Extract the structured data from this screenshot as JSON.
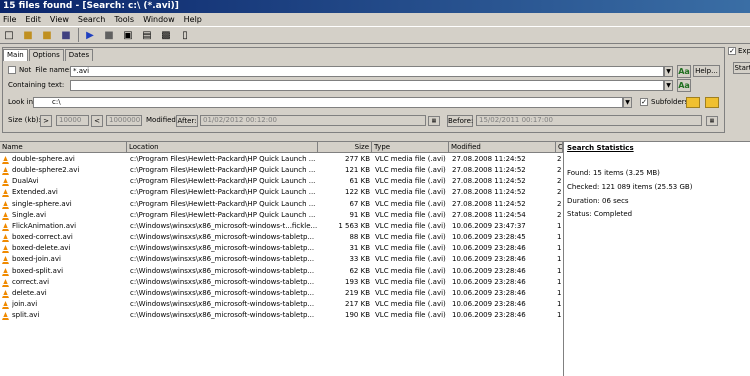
{
  "window": {
    "title": "15 files found - [Search: c:\\ (*.avi)]"
  },
  "menu": [
    "File",
    "Edit",
    "View",
    "Search",
    "Tools",
    "Window",
    "Help"
  ],
  "tabs": [
    "Main",
    "Options",
    "Dates"
  ],
  "main": {
    "not_label": "Not",
    "file_name_label": "File name:",
    "file_name_value": "*.avi",
    "containing_text_label": "Containing text:",
    "containing_text_value": "",
    "look_in_label": "Look in:",
    "look_in_value": "c:\\",
    "subfolders_label": "Subfolders",
    "help_label": "Help...",
    "aa_label": "Aa",
    "size_label": "Size (kb):",
    "size_min_op": ">",
    "size_min_value": "10000",
    "size_max_op": "<",
    "size_max_value": "1000000",
    "modified_label": "Modified:",
    "after_label": "After:",
    "after_value": "01/02/2012 00:12:00",
    "before_label": "Before:",
    "before_value": "15/02/2011 00:17:00"
  },
  "right": {
    "exp_label": "Exp",
    "start_label": "Start"
  },
  "columns": [
    "Name",
    "Location",
    "Size",
    "Type",
    "Modified",
    "C"
  ],
  "files": [
    {
      "name": "double-sphere.avi",
      "location": "c:\\Program Files\\Hewlett-Packard\\HP Quick Launch ...",
      "size": "277 KB",
      "type": "VLC media file (.avi)",
      "modified": "27.08.2008 11:24:52",
      "c": "2"
    },
    {
      "name": "double-sphere2.avi",
      "location": "c:\\Program Files\\Hewlett-Packard\\HP Quick Launch ...",
      "size": "121 KB",
      "type": "VLC media file (.avi)",
      "modified": "27.08.2008 11:24:52",
      "c": "2"
    },
    {
      "name": "DualAvi",
      "location": "c:\\Program Files\\Hewlett-Packard\\HP Quick Launch ...",
      "size": "61 KB",
      "type": "VLC media file (.avi)",
      "modified": "27.08.2008 11:24:52",
      "c": "2"
    },
    {
      "name": "Extended.avi",
      "location": "c:\\Program Files\\Hewlett-Packard\\HP Quick Launch ...",
      "size": "122 KB",
      "type": "VLC media file (.avi)",
      "modified": "27.08.2008 11:24:52",
      "c": "2"
    },
    {
      "name": "single-sphere.avi",
      "location": "c:\\Program Files\\Hewlett-Packard\\HP Quick Launch ...",
      "size": "67 KB",
      "type": "VLC media file (.avi)",
      "modified": "27.08.2008 11:24:52",
      "c": "2"
    },
    {
      "name": "Single.avi",
      "location": "c:\\Program Files\\Hewlett-Packard\\HP Quick Launch ...",
      "size": "91 KB",
      "type": "VLC media file (.avi)",
      "modified": "27.08.2008 11:24:54",
      "c": "2"
    },
    {
      "name": "FlickAnimation.avi",
      "location": "c:\\Windows\\winsxs\\x86_microsoft-windows-t...fickle...",
      "size": "1 563 KB",
      "type": "VLC media file (.avi)",
      "modified": "10.06.2009 23:47:37",
      "c": "1"
    },
    {
      "name": "boxed-correct.avi",
      "location": "c:\\Windows\\winsxs\\x86_microsoft-windows-tabletp...",
      "size": "88 KB",
      "type": "VLC media file (.avi)",
      "modified": "10.06.2009 23:28:45",
      "c": "1"
    },
    {
      "name": "boxed-delete.avi",
      "location": "c:\\Windows\\winsxs\\x86_microsoft-windows-tabletp...",
      "size": "31 KB",
      "type": "VLC media file (.avi)",
      "modified": "10.06.2009 23:28:46",
      "c": "1"
    },
    {
      "name": "boxed-join.avi",
      "location": "c:\\Windows\\winsxs\\x86_microsoft-windows-tabletp...",
      "size": "33 KB",
      "type": "VLC media file (.avi)",
      "modified": "10.06.2009 23:28:46",
      "c": "1"
    },
    {
      "name": "boxed-split.avi",
      "location": "c:\\Windows\\winsxs\\x86_microsoft-windows-tabletp...",
      "size": "62 KB",
      "type": "VLC media file (.avi)",
      "modified": "10.06.2009 23:28:46",
      "c": "1"
    },
    {
      "name": "correct.avi",
      "location": "c:\\Windows\\winsxs\\x86_microsoft-windows-tabletp...",
      "size": "193 KB",
      "type": "VLC media file (.avi)",
      "modified": "10.06.2009 23:28:46",
      "c": "1"
    },
    {
      "name": "delete.avi",
      "location": "c:\\Windows\\winsxs\\x86_microsoft-windows-tabletp...",
      "size": "219 KB",
      "type": "VLC media file (.avi)",
      "modified": "10.06.2009 23:28:46",
      "c": "1"
    },
    {
      "name": "join.avi",
      "location": "c:\\Windows\\winsxs\\x86_microsoft-windows-tabletp...",
      "size": "217 KB",
      "type": "VLC media file (.avi)",
      "modified": "10.06.2009 23:28:46",
      "c": "1"
    },
    {
      "name": "split.avi",
      "location": "c:\\Windows\\winsxs\\x86_microsoft-windows-tabletp...",
      "size": "190 KB",
      "type": "VLC media file (.avi)",
      "modified": "10.06.2009 23:28:46",
      "c": "1"
    }
  ],
  "stats": {
    "title": "Search Statistics",
    "found": "Found: 15 items (3.25 MB)",
    "checked": "Checked: 121 089 items (25.53 GB)",
    "duration": "Duration: 06 secs",
    "status": "Status: Completed"
  }
}
